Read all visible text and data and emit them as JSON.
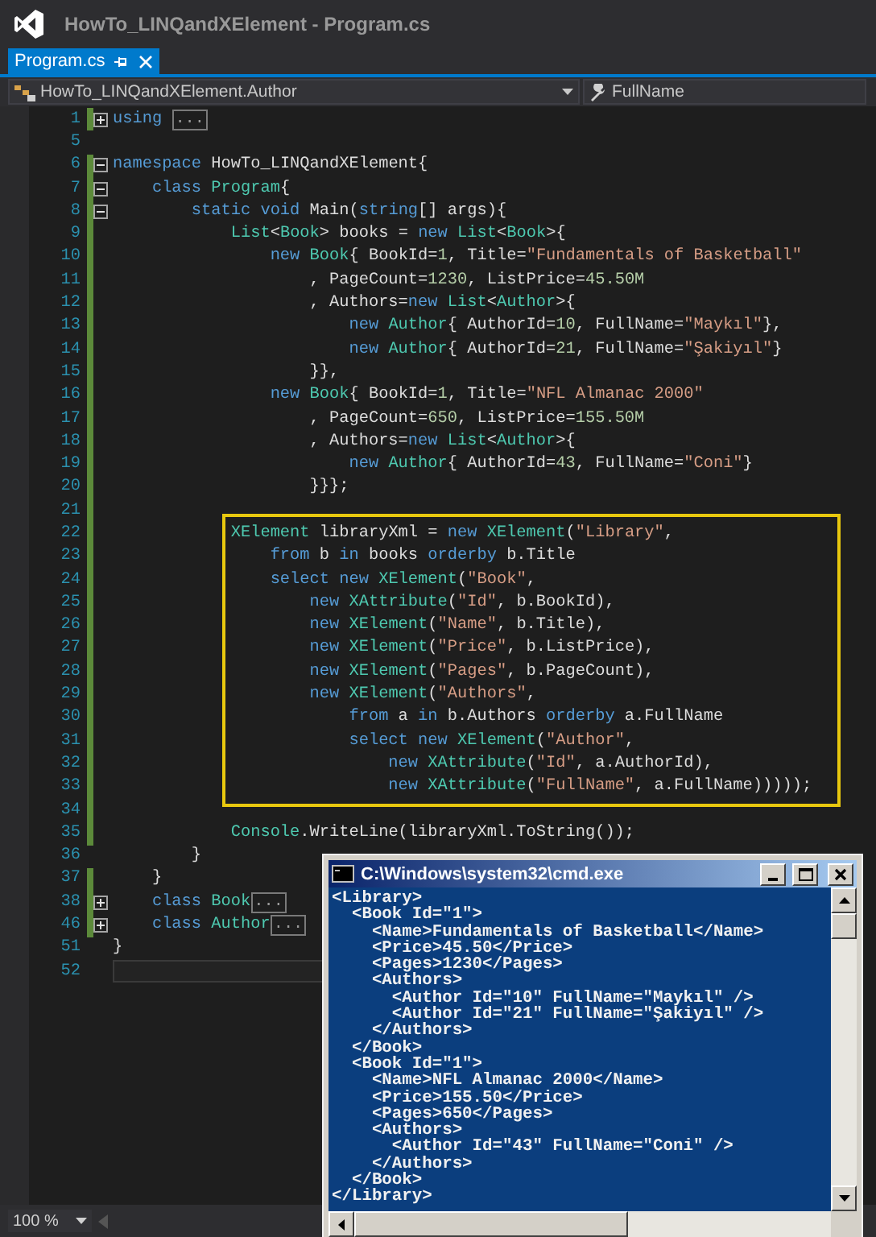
{
  "window": {
    "title": "HowTo_LINQandXElement - Program.cs"
  },
  "tabs": [
    {
      "label": "Program.cs",
      "selected": true
    }
  ],
  "navigation": {
    "type_dropdown": "HowTo_LINQandXElement.Author",
    "member_dropdown": "FullName"
  },
  "code": {
    "blocks": [
      {
        "boxed": false,
        "lines": [
          {
            "number": "1",
            "changed": true,
            "expanded": false,
            "current": false,
            "tokens": [
              {
                "kind": "kw",
                "text": "using "
              },
              {
                "kind": "collapsed",
                "text": "..."
              }
            ]
          },
          {
            "number": "5",
            "changed": false,
            "current": false
          },
          {
            "number": "6",
            "changed": true,
            "expanded": true,
            "current": false,
            "tokens": [
              {
                "kind": "kw",
                "text": "namespace"
              },
              {
                "kind": "plain",
                "text": " HowTo_LINQandXElement{"
              }
            ]
          },
          {
            "number": "7",
            "changed": true,
            "expanded": true,
            "current": false,
            "tokens": [
              {
                "kind": "kw",
                "text": "    class"
              },
              {
                "kind": "type",
                "text": " Program"
              },
              {
                "kind": "plain",
                "text": "{"
              }
            ]
          },
          {
            "number": "8",
            "changed": true,
            "expanded": true,
            "current": false,
            "tokens": [
              {
                "kind": "kw",
                "text": "        static"
              },
              {
                "kind": "kw",
                "text": " void"
              },
              {
                "kind": "plain",
                "text": " Main("
              },
              {
                "kind": "kw",
                "text": "string"
              },
              {
                "kind": "plain",
                "text": "[] args){"
              }
            ]
          },
          {
            "number": "9",
            "changed": true,
            "current": false,
            "tokens": [
              {
                "kind": "type",
                "text": "            List"
              },
              {
                "kind": "plain",
                "text": "<"
              },
              {
                "kind": "type",
                "text": "Book"
              },
              {
                "kind": "plain",
                "text": "> books = "
              },
              {
                "kind": "kw",
                "text": "new"
              },
              {
                "kind": "type",
                "text": " List"
              },
              {
                "kind": "plain",
                "text": "<"
              },
              {
                "kind": "type",
                "text": "Book"
              },
              {
                "kind": "plain",
                "text": ">{"
              }
            ]
          },
          {
            "number": "10",
            "changed": true,
            "current": false,
            "tokens": [
              {
                "kind": "kw",
                "text": "                new"
              },
              {
                "kind": "type",
                "text": " Book"
              },
              {
                "kind": "plain",
                "text": "{ BookId="
              },
              {
                "kind": "num",
                "text": "1"
              },
              {
                "kind": "plain",
                "text": ", Title="
              },
              {
                "kind": "str",
                "text": "\"Fundamentals of Basketball\""
              }
            ]
          },
          {
            "number": "11",
            "changed": true,
            "current": false,
            "tokens": [
              {
                "kind": "plain",
                "text": "                    , PageCount="
              },
              {
                "kind": "num",
                "text": "1230"
              },
              {
                "kind": "plain",
                "text": ", ListPrice="
              },
              {
                "kind": "num",
                "text": "45.50M"
              }
            ]
          },
          {
            "number": "12",
            "changed": true,
            "current": false,
            "tokens": [
              {
                "kind": "plain",
                "text": "                    , Authors="
              },
              {
                "kind": "kw",
                "text": "new"
              },
              {
                "kind": "type",
                "text": " List"
              },
              {
                "kind": "plain",
                "text": "<"
              },
              {
                "kind": "type",
                "text": "Author"
              },
              {
                "kind": "plain",
                "text": ">{"
              }
            ]
          },
          {
            "number": "13",
            "changed": true,
            "current": false,
            "tokens": [
              {
                "kind": "kw",
                "text": "                        new"
              },
              {
                "kind": "type",
                "text": " Author"
              },
              {
                "kind": "plain",
                "text": "{ AuthorId="
              },
              {
                "kind": "num",
                "text": "10"
              },
              {
                "kind": "plain",
                "text": ", FullName="
              },
              {
                "kind": "str",
                "text": "\"Maykıl\""
              },
              {
                "kind": "plain",
                "text": "},"
              }
            ]
          },
          {
            "number": "14",
            "changed": true,
            "current": false,
            "tokens": [
              {
                "kind": "kw",
                "text": "                        new"
              },
              {
                "kind": "type",
                "text": " Author"
              },
              {
                "kind": "plain",
                "text": "{ AuthorId="
              },
              {
                "kind": "num",
                "text": "21"
              },
              {
                "kind": "plain",
                "text": ", FullName="
              },
              {
                "kind": "str",
                "text": "\"Şakiyıl\""
              },
              {
                "kind": "plain",
                "text": "}"
              }
            ]
          },
          {
            "number": "15",
            "changed": true,
            "current": false,
            "tokens": [
              {
                "kind": "plain",
                "text": "                    }},"
              }
            ]
          },
          {
            "number": "16",
            "changed": true,
            "current": false,
            "tokens": [
              {
                "kind": "kw",
                "text": "                new"
              },
              {
                "kind": "type",
                "text": " Book"
              },
              {
                "kind": "plain",
                "text": "{ BookId="
              },
              {
                "kind": "num",
                "text": "1"
              },
              {
                "kind": "plain",
                "text": ", Title="
              },
              {
                "kind": "str",
                "text": "\"NFL Almanac 2000\""
              }
            ]
          },
          {
            "number": "17",
            "changed": true,
            "current": false,
            "tokens": [
              {
                "kind": "plain",
                "text": "                    , PageCount="
              },
              {
                "kind": "num",
                "text": "650"
              },
              {
                "kind": "plain",
                "text": ", ListPrice="
              },
              {
                "kind": "num",
                "text": "155.50M"
              }
            ]
          },
          {
            "number": "18",
            "changed": true,
            "current": false,
            "tokens": [
              {
                "kind": "plain",
                "text": "                    , Authors="
              },
              {
                "kind": "kw",
                "text": "new"
              },
              {
                "kind": "type",
                "text": " List"
              },
              {
                "kind": "plain",
                "text": "<"
              },
              {
                "kind": "type",
                "text": "Author"
              },
              {
                "kind": "plain",
                "text": ">{"
              }
            ]
          },
          {
            "number": "19",
            "changed": true,
            "current": false,
            "tokens": [
              {
                "kind": "kw",
                "text": "                        new"
              },
              {
                "kind": "type",
                "text": " Author"
              },
              {
                "kind": "plain",
                "text": "{ AuthorId="
              },
              {
                "kind": "num",
                "text": "43"
              },
              {
                "kind": "plain",
                "text": ", FullName="
              },
              {
                "kind": "str",
                "text": "\"Coni\""
              },
              {
                "kind": "plain",
                "text": "}"
              }
            ]
          },
          {
            "number": "20",
            "changed": true,
            "current": false,
            "tokens": [
              {
                "kind": "plain",
                "text": "                    }}};"
              }
            ]
          },
          {
            "number": "21",
            "changed": true,
            "current": false
          }
        ]
      },
      {
        "boxed": true,
        "lines": [
          {
            "number": "22",
            "changed": true,
            "current": false,
            "tokens": [
              {
                "kind": "type",
                "text": "            XElement"
              },
              {
                "kind": "plain",
                "text": " libraryXml = "
              },
              {
                "kind": "kw",
                "text": "new"
              },
              {
                "kind": "type",
                "text": " XElement"
              },
              {
                "kind": "plain",
                "text": "("
              },
              {
                "kind": "str",
                "text": "\"Library\""
              },
              {
                "kind": "plain",
                "text": ","
              }
            ]
          },
          {
            "number": "23",
            "changed": true,
            "current": false,
            "tokens": [
              {
                "kind": "kw",
                "text": "                from"
              },
              {
                "kind": "plain",
                "text": " b "
              },
              {
                "kind": "kw",
                "text": "in"
              },
              {
                "kind": "plain",
                "text": " books "
              },
              {
                "kind": "kw",
                "text": "orderby"
              },
              {
                "kind": "plain",
                "text": " b.Title"
              }
            ]
          },
          {
            "number": "24",
            "changed": true,
            "current": false,
            "tokens": [
              {
                "kind": "kw",
                "text": "                select"
              },
              {
                "kind": "kw",
                "text": " new"
              },
              {
                "kind": "type",
                "text": " XElement"
              },
              {
                "kind": "plain",
                "text": "("
              },
              {
                "kind": "str",
                "text": "\"Book\""
              },
              {
                "kind": "plain",
                "text": ","
              }
            ]
          },
          {
            "number": "25",
            "changed": true,
            "current": false,
            "tokens": [
              {
                "kind": "kw",
                "text": "                    new"
              },
              {
                "kind": "type",
                "text": " XAttribute"
              },
              {
                "kind": "plain",
                "text": "("
              },
              {
                "kind": "str",
                "text": "\"Id\""
              },
              {
                "kind": "plain",
                "text": ", b.BookId),"
              }
            ]
          },
          {
            "number": "26",
            "changed": true,
            "current": false,
            "tokens": [
              {
                "kind": "kw",
                "text": "                    new"
              },
              {
                "kind": "type",
                "text": " XElement"
              },
              {
                "kind": "plain",
                "text": "("
              },
              {
                "kind": "str",
                "text": "\"Name\""
              },
              {
                "kind": "plain",
                "text": ", b.Title),"
              }
            ]
          },
          {
            "number": "27",
            "changed": true,
            "current": false,
            "tokens": [
              {
                "kind": "kw",
                "text": "                    new"
              },
              {
                "kind": "type",
                "text": " XElement"
              },
              {
                "kind": "plain",
                "text": "("
              },
              {
                "kind": "str",
                "text": "\"Price\""
              },
              {
                "kind": "plain",
                "text": ", b.ListPrice),"
              }
            ]
          },
          {
            "number": "28",
            "changed": true,
            "current": false,
            "tokens": [
              {
                "kind": "kw",
                "text": "                    new"
              },
              {
                "kind": "type",
                "text": " XElement"
              },
              {
                "kind": "plain",
                "text": "("
              },
              {
                "kind": "str",
                "text": "\"Pages\""
              },
              {
                "kind": "plain",
                "text": ", b.PageCount),"
              }
            ]
          },
          {
            "number": "29",
            "changed": true,
            "current": false,
            "tokens": [
              {
                "kind": "kw",
                "text": "                    new"
              },
              {
                "kind": "type",
                "text": " XElement"
              },
              {
                "kind": "plain",
                "text": "("
              },
              {
                "kind": "str",
                "text": "\"Authors\""
              },
              {
                "kind": "plain",
                "text": ","
              }
            ]
          },
          {
            "number": "30",
            "changed": true,
            "current": false,
            "tokens": [
              {
                "kind": "kw",
                "text": "                        from"
              },
              {
                "kind": "plain",
                "text": " a "
              },
              {
                "kind": "kw",
                "text": "in"
              },
              {
                "kind": "plain",
                "text": " b.Authors "
              },
              {
                "kind": "kw",
                "text": "orderby"
              },
              {
                "kind": "plain",
                "text": " a.FullName"
              }
            ]
          },
          {
            "number": "31",
            "changed": true,
            "current": false,
            "tokens": [
              {
                "kind": "kw",
                "text": "                        select"
              },
              {
                "kind": "kw",
                "text": " new"
              },
              {
                "kind": "type",
                "text": " XElement"
              },
              {
                "kind": "plain",
                "text": "("
              },
              {
                "kind": "str",
                "text": "\"Author\""
              },
              {
                "kind": "plain",
                "text": ","
              }
            ]
          },
          {
            "number": "32",
            "changed": true,
            "current": false,
            "tokens": [
              {
                "kind": "kw",
                "text": "                            new"
              },
              {
                "kind": "type",
                "text": " XAttribute"
              },
              {
                "kind": "plain",
                "text": "("
              },
              {
                "kind": "str",
                "text": "\"Id\""
              },
              {
                "kind": "plain",
                "text": ", a.AuthorId),"
              }
            ]
          },
          {
            "number": "33",
            "changed": true,
            "current": false,
            "tokens": [
              {
                "kind": "kw",
                "text": "                            new"
              },
              {
                "kind": "type",
                "text": " XAttribute"
              },
              {
                "kind": "plain",
                "text": "("
              },
              {
                "kind": "str",
                "text": "\"FullName\""
              },
              {
                "kind": "plain",
                "text": ", a.FullName)))));"
              }
            ]
          }
        ]
      },
      {
        "boxed": false,
        "lines": [
          {
            "number": "34",
            "changed": true,
            "current": false
          },
          {
            "number": "35",
            "changed": true,
            "current": false,
            "tokens": [
              {
                "kind": "type",
                "text": "            Console"
              },
              {
                "kind": "plain",
                "text": ".WriteLine(libraryXml.ToString());"
              }
            ]
          },
          {
            "number": "36",
            "changed": false,
            "current": false,
            "tokens": [
              {
                "kind": "plain",
                "text": "        }"
              }
            ]
          },
          {
            "number": "37",
            "changed": true,
            "current": false,
            "tokens": [
              {
                "kind": "plain",
                "text": "    }"
              }
            ]
          },
          {
            "number": "38",
            "changed": true,
            "expanded": false,
            "current": false,
            "tokens": [
              {
                "kind": "kw",
                "text": "    class"
              },
              {
                "kind": "type",
                "text": " Book"
              },
              {
                "kind": "collapsed",
                "text": "..."
              }
            ]
          },
          {
            "number": "46",
            "changed": true,
            "expanded": false,
            "current": false,
            "tokens": [
              {
                "kind": "kw",
                "text": "    class"
              },
              {
                "kind": "type",
                "text": " Author"
              },
              {
                "kind": "collapsed",
                "text": "..."
              }
            ]
          },
          {
            "number": "51",
            "changed": false,
            "current": false,
            "tokens": [
              {
                "kind": "plain",
                "text": "}"
              }
            ]
          },
          {
            "number": "52",
            "changed": false,
            "current": true
          }
        ]
      }
    ]
  },
  "status_bar": {
    "zoom": "100 %"
  },
  "console": {
    "title": "C:\\Windows\\system32\\cmd.exe",
    "lines": [
      "<Library>",
      "  <Book Id=\"1\">",
      "    <Name>Fundamentals of Basketball</Name>",
      "    <Price>45.50</Price>",
      "    <Pages>1230</Pages>",
      "    <Authors>",
      "      <Author Id=\"10\" FullName=\"Maykıl\" />",
      "      <Author Id=\"21\" FullName=\"Şakiyıl\" />",
      "    </Authors>",
      "  </Book>",
      "  <Book Id=\"1\">",
      "    <Name>NFL Almanac 2000</Name>",
      "    <Price>155.50</Price>",
      "    <Pages>650</Pages>",
      "    <Authors>",
      "      <Author Id=\"43\" FullName=\"Coni\" />",
      "    </Authors>",
      "  </Book>",
      "</Library>"
    ]
  }
}
